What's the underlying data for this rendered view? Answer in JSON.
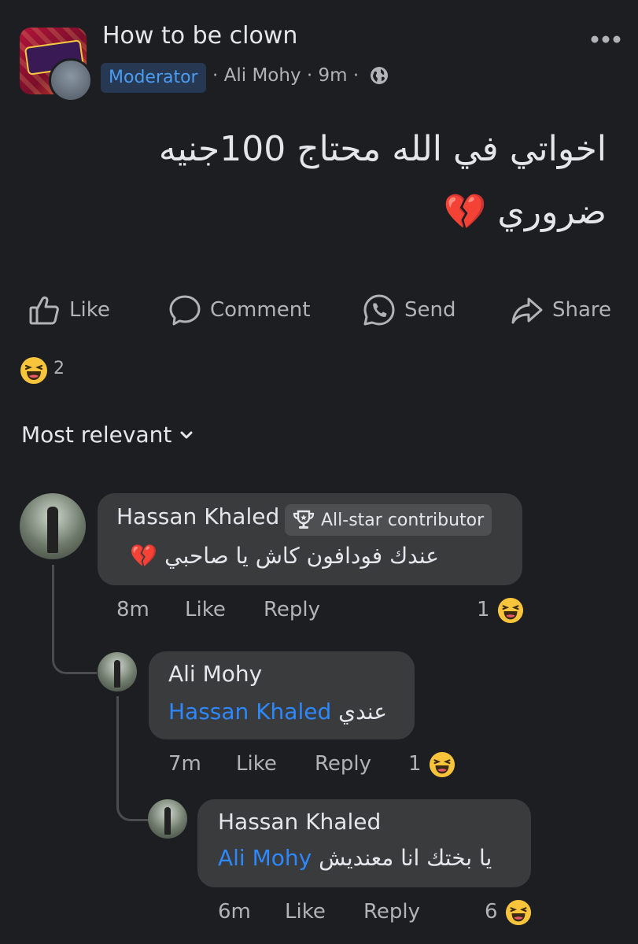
{
  "post": {
    "group_name": "How to be clown",
    "role_badge": "Moderator",
    "separator": "·",
    "author": "Ali Mohy",
    "time": "9m",
    "text_line1": "اخواتي في الله محتاج 100جنيه",
    "text_line2": "ضروري 💔",
    "reaction_count": "2"
  },
  "actions": {
    "like": "Like",
    "comment": "Comment",
    "send": "Send",
    "share": "Share"
  },
  "sort": {
    "label": "Most relevant"
  },
  "comments": [
    {
      "author": "Hassan Khaled",
      "badge": "All-star contributor",
      "text": "عندك فودافون كاش يا صاحبي 💔",
      "time": "8m",
      "like": "Like",
      "reply": "Reply",
      "reactions": "1"
    },
    {
      "author": "Ali Mohy",
      "mention": "Hassan Khaled",
      "text": "عندي",
      "time": "7m",
      "like": "Like",
      "reply": "Reply",
      "reactions": "1"
    },
    {
      "author": "Hassan Khaled",
      "mention": "Ali Mohy",
      "text": "يا بختك انا معنديش",
      "time": "6m",
      "like": "Like",
      "reply": "Reply",
      "reactions": "6"
    }
  ],
  "icons": {
    "header": [
      "globe-icon",
      "more-icon"
    ],
    "actions": [
      "like-icon",
      "comment-icon",
      "whatsapp-send-icon",
      "share-icon"
    ],
    "reaction": "haha-emoji-icon",
    "badge": "trophy-icon",
    "sort": "chevron-down-icon"
  },
  "colors": {
    "background": "#1c1e21",
    "bubble": "#3a3b3c",
    "mention": "#2d88ff",
    "moderator_badge": "#263852"
  }
}
